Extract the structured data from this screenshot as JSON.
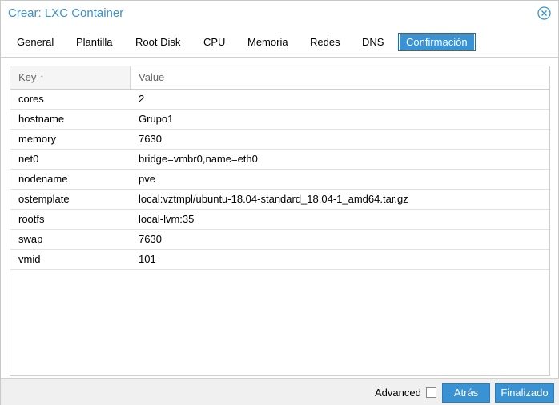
{
  "window": {
    "title": "Crear: LXC Container",
    "close_icon": "close-circle-icon"
  },
  "tabs": [
    {
      "label": "General"
    },
    {
      "label": "Plantilla"
    },
    {
      "label": "Root Disk"
    },
    {
      "label": "CPU"
    },
    {
      "label": "Memoria"
    },
    {
      "label": "Redes"
    },
    {
      "label": "DNS"
    },
    {
      "label": "Confirmación",
      "active": true
    }
  ],
  "grid": {
    "columns": {
      "key": "Key",
      "value": "Value",
      "sort_icon": "arrow-up-icon"
    },
    "rows": [
      {
        "key": "cores",
        "value": "2"
      },
      {
        "key": "hostname",
        "value": "Grupo1"
      },
      {
        "key": "memory",
        "value": "7630"
      },
      {
        "key": "net0",
        "value": "bridge=vmbr0,name=eth0"
      },
      {
        "key": "nodename",
        "value": "pve"
      },
      {
        "key": "ostemplate",
        "value": "local:vztmpl/ubuntu-18.04-standard_18.04-1_amd64.tar.gz"
      },
      {
        "key": "rootfs",
        "value": "local-lvm:35"
      },
      {
        "key": "swap",
        "value": "7630"
      },
      {
        "key": "vmid",
        "value": "101"
      }
    ]
  },
  "footer": {
    "advanced_label": "Advanced",
    "advanced_checked": false,
    "back_label": "Atrás",
    "finish_label": "Finalizado"
  },
  "colors": {
    "accent": "#3892d4",
    "border": "#cfcfcf",
    "footer_bg": "#f0f0f0"
  }
}
